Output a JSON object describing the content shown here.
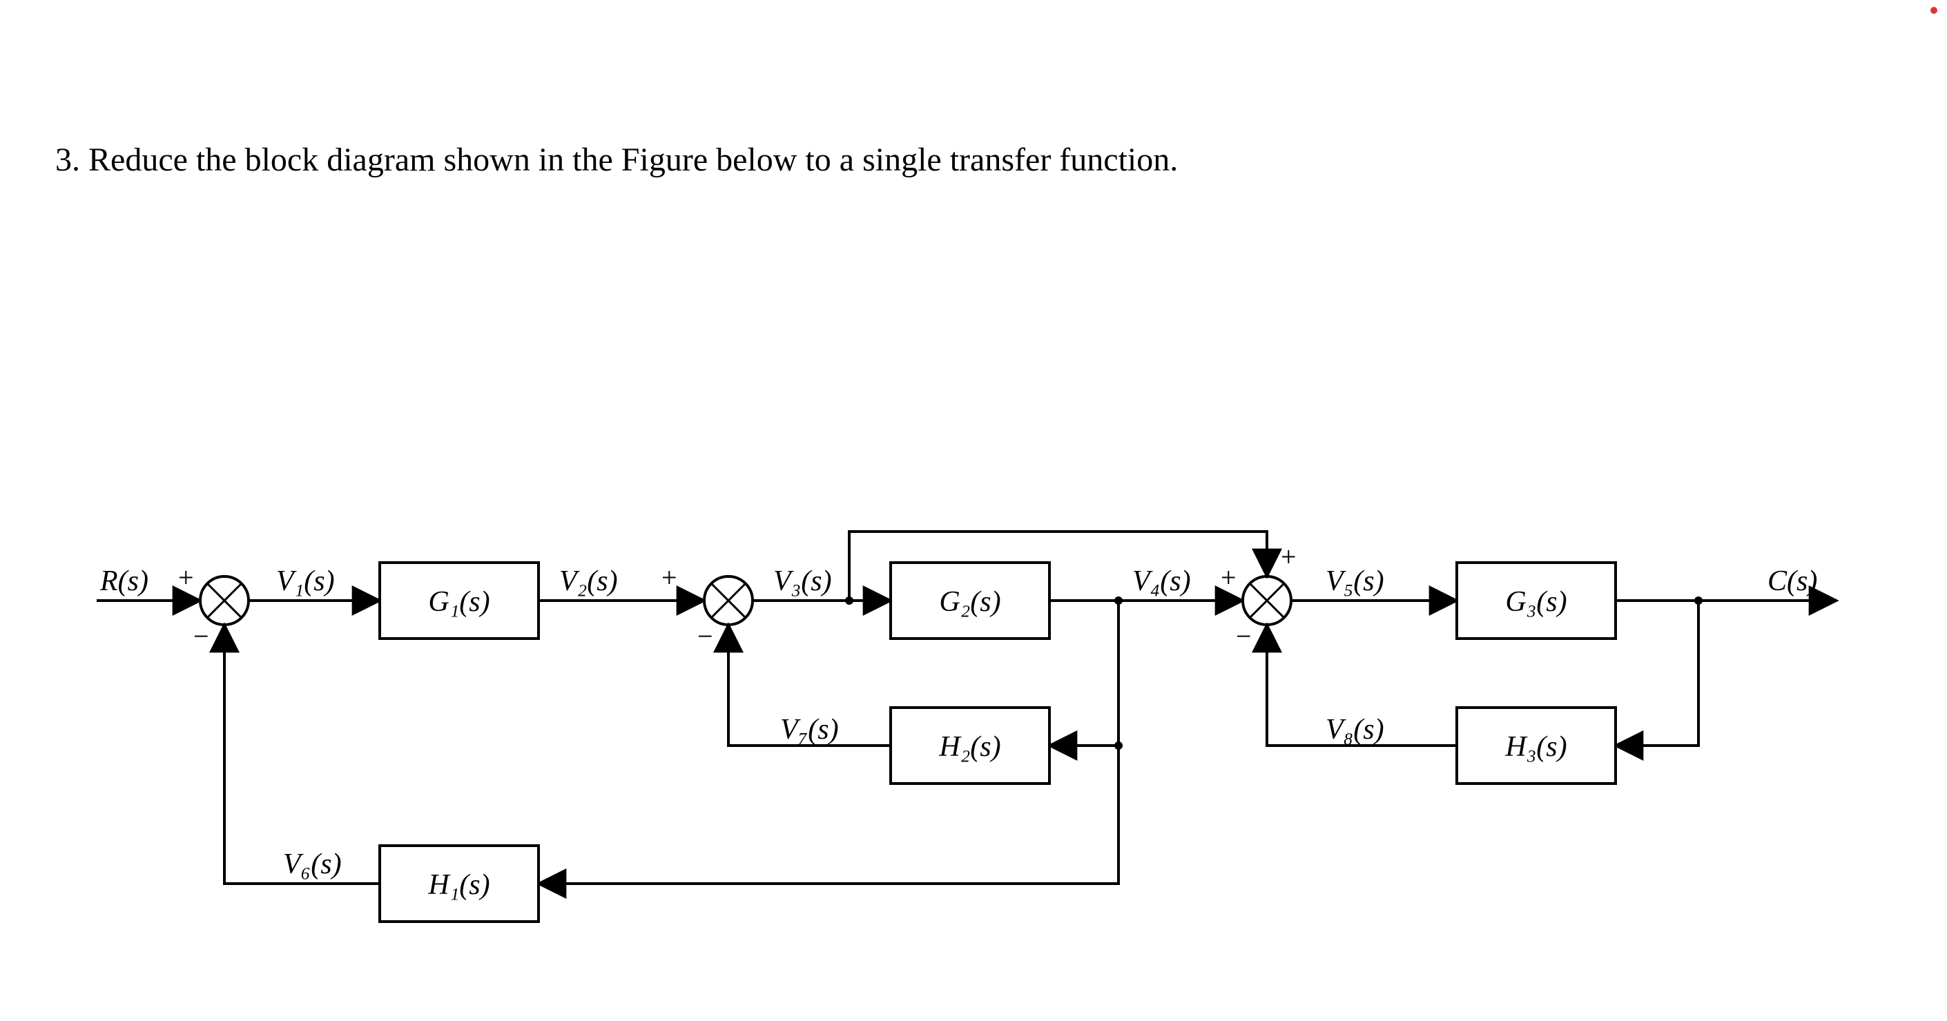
{
  "question": {
    "number": "3.",
    "text": "Reduce the block diagram shown in the Figure below to a single transfer function."
  },
  "labels": {
    "R": "R(s)",
    "C": "C(s)",
    "plus": "+",
    "minus": "−",
    "V1": "V₁(s)",
    "V2": "V₂(s)",
    "V3": "V₃(s)",
    "V4": "V₄(s)",
    "V5": "V₅(s)",
    "V6": "V₆(s)",
    "V7": "V₇(s)",
    "V8": "V₈(s)"
  },
  "blocks": {
    "G1": "G₁(s)",
    "G2": "G₂(s)",
    "G3": "G₃(s)",
    "H1": "H₁(s)",
    "H2": "H₂(s)",
    "H3": "H₃(s)"
  }
}
